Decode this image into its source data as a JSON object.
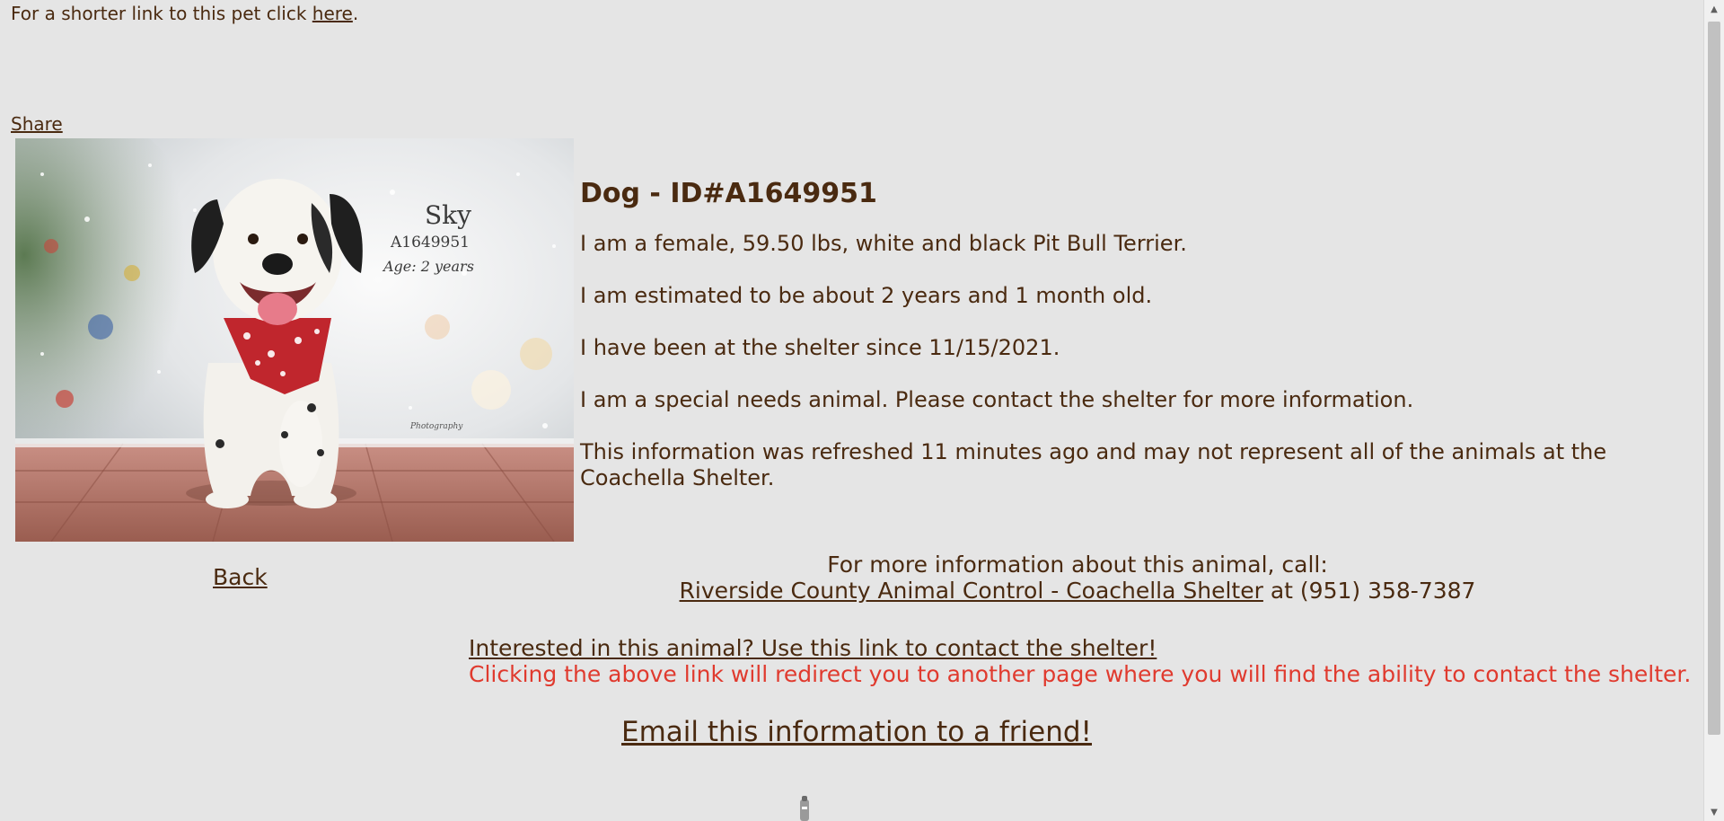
{
  "top": {
    "shorter_link_prefix": "For a shorter link to this pet click ",
    "shorter_link_text": "here",
    "shorter_link_suffix": "."
  },
  "share_label": "Share",
  "photo": {
    "overlay_name": "Sky",
    "overlay_id": "A1649951",
    "overlay_age": "Age: 2 years",
    "watermark": "Photography"
  },
  "back_label": "Back",
  "details": {
    "title": "Dog - ID#A1649951",
    "line1": "I am a female, 59.50 lbs, white and black Pit Bull Terrier.",
    "line2": "I am estimated to be about 2 years and 1 month old.",
    "line3": "I have been at the shelter since 11/15/2021.",
    "line4": "I am a special needs animal. Please contact the shelter for more information.",
    "line5": "This information was refreshed 11 minutes ago and may not represent all of the animals at the Coachella Shelter."
  },
  "call": {
    "heading": "For more information about this animal, call:",
    "shelter_link": "Riverside County Animal Control - Coachella Shelter",
    "phone_text": " at (951) 358-7387"
  },
  "interest": {
    "link_text": "Interested in this animal? Use this link to contact the shelter!",
    "note": "Clicking the above link will redirect you to another page where you will find the ability to contact the shelter."
  },
  "email_label": "Email this information to a friend!",
  "colors": {
    "background": "#e5e5e5",
    "text": "#4a2a10",
    "warning": "#e03a2e"
  }
}
